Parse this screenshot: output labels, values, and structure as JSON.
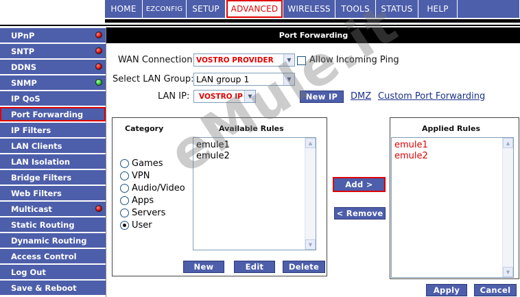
{
  "topnav": {
    "tabs": [
      {
        "label": "HOME"
      },
      {
        "label": "EZCONFIG"
      },
      {
        "label": "SETUP"
      },
      {
        "label": "ADVANCED"
      },
      {
        "label": "WIRELESS"
      },
      {
        "label": "TOOLS"
      },
      {
        "label": "STATUS"
      },
      {
        "label": "HELP"
      }
    ],
    "active_tab": "ADVANCED"
  },
  "sidebar": {
    "items": [
      {
        "label": "UPnP",
        "status": "red"
      },
      {
        "label": "SNTP",
        "status": "red"
      },
      {
        "label": "DDNS",
        "status": "red"
      },
      {
        "label": "SNMP",
        "status": "green"
      },
      {
        "label": "IP QoS"
      },
      {
        "label": "Port Forwarding",
        "selected": true
      },
      {
        "label": "IP Filters"
      },
      {
        "label": "LAN Clients"
      },
      {
        "label": "LAN Isolation"
      },
      {
        "label": "Bridge Filters"
      },
      {
        "label": "Web Filters"
      },
      {
        "label": "Multicast",
        "status": "red"
      },
      {
        "label": "Static Routing"
      },
      {
        "label": "Dynamic Routing"
      },
      {
        "label": "Access Control"
      },
      {
        "label": "Log Out"
      },
      {
        "label": "Save & Reboot"
      }
    ]
  },
  "main": {
    "title": "Port Forwarding",
    "wan_connection": {
      "label": "WAN Connection:",
      "value": "VOSTRO PROVIDER"
    },
    "allow_ping": {
      "label": "Allow Incoming Ping",
      "checked": false
    },
    "lan_group": {
      "label": "Select LAN Group:",
      "value": "LAN group 1"
    },
    "lan_ip": {
      "label": "LAN IP:",
      "value": "VOSTRO IP"
    },
    "new_ip_button": "New IP",
    "dmz_link": "DMZ",
    "custom_link": "Custom Port Forwarding",
    "category": {
      "header": "Category",
      "options": [
        {
          "label": "Games",
          "checked": false
        },
        {
          "label": "VPN",
          "checked": false
        },
        {
          "label": "Audio/Video",
          "checked": false
        },
        {
          "label": "Apps",
          "checked": false
        },
        {
          "label": "Servers",
          "checked": false
        },
        {
          "label": "User",
          "checked": true
        }
      ]
    },
    "available_rules": {
      "header": "Available Rules",
      "items": [
        "emule1",
        "emule2"
      ]
    },
    "applied_rules": {
      "header": "Applied Rules",
      "items": [
        "emule1",
        "emule2"
      ]
    },
    "buttons": {
      "new": "New",
      "edit": "Edit",
      "delete": "Delete",
      "add": "Add >",
      "remove": "< Remove",
      "apply": "Apply",
      "cancel": "Cancel"
    }
  },
  "watermark": "eMule.it",
  "colors": {
    "nav_blue": "#4d5eaa",
    "highlight_red": "#e00000",
    "led_red": "#d40000",
    "led_green": "#1fbf1f"
  }
}
